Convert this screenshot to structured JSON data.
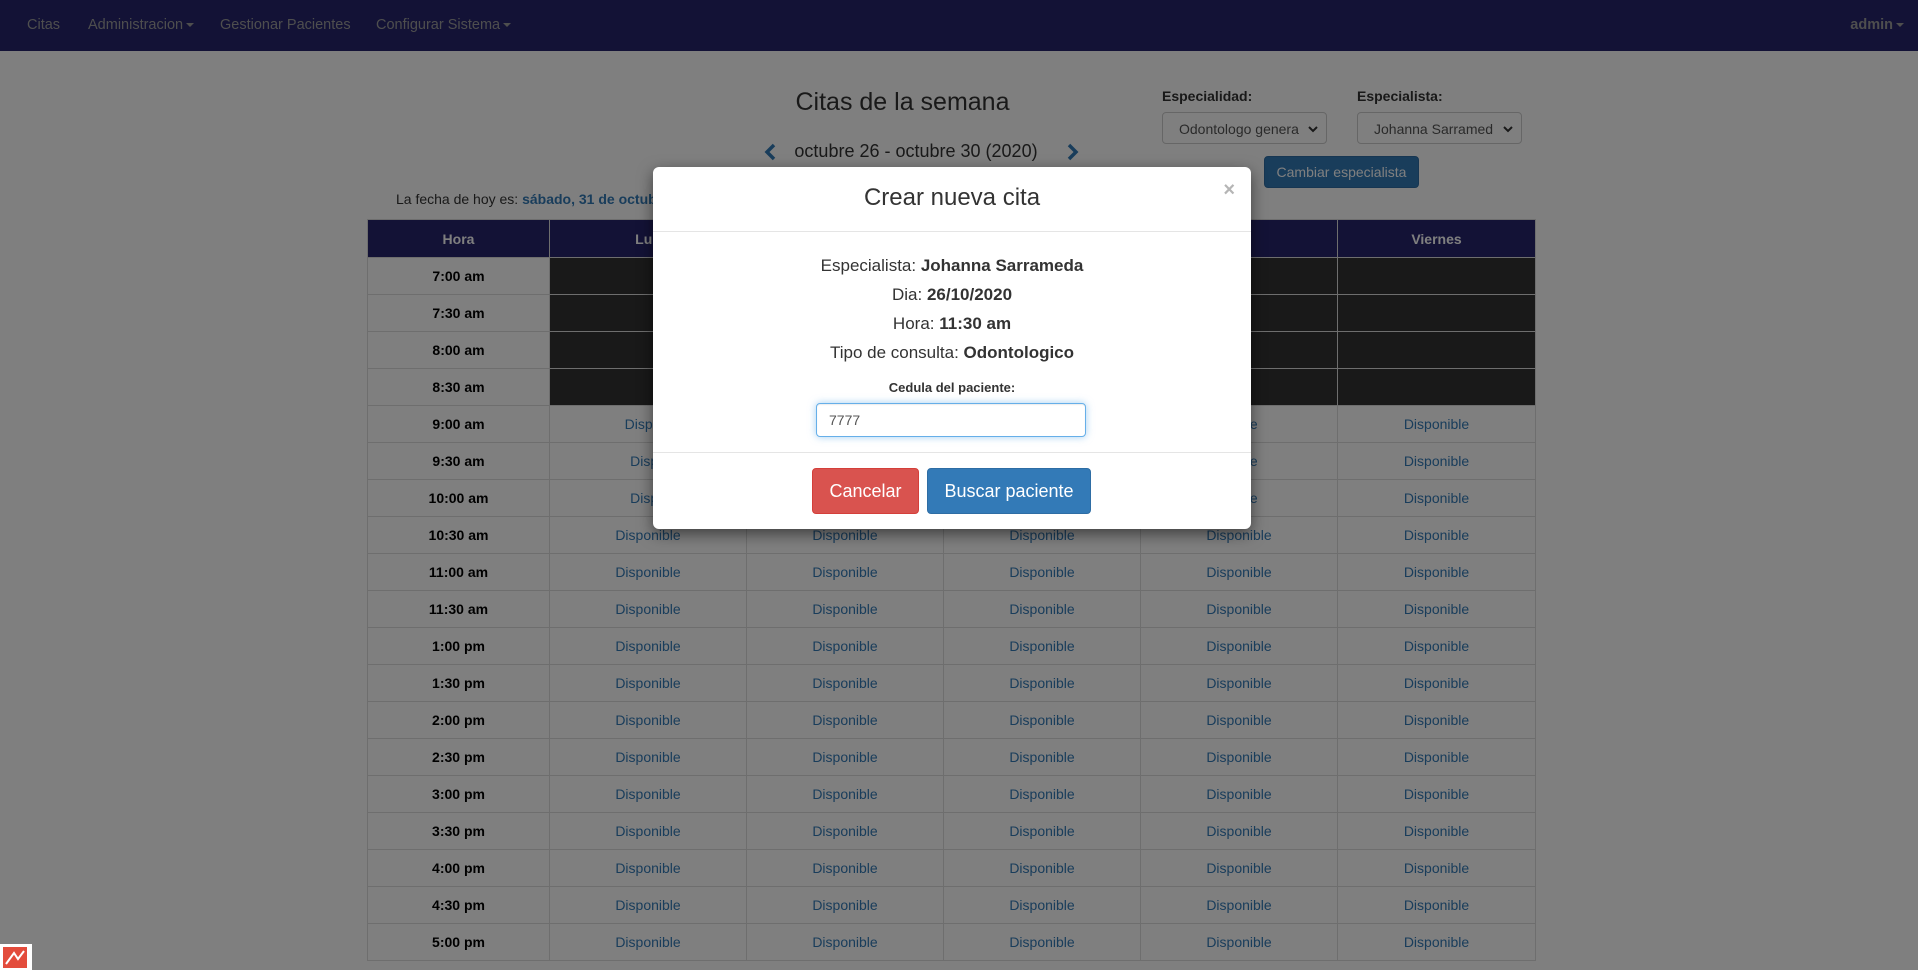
{
  "navbar": {
    "items": [
      "Citas",
      "Administracion",
      "Gestionar Pacientes",
      "Configurar Sistema"
    ],
    "user": "admin"
  },
  "page": {
    "title": "Citas de la semana",
    "week_label": "octubre 26 - octubre 30 (2020)",
    "today_prefix": "La fecha de hoy es:",
    "today_value": "sábado, 31 de octub",
    "especialidad_label": "Especialidad:",
    "especialidad_value": "Odontologo genera",
    "especialista_label": "Especialista:",
    "especialista_value": "Johanna Sarramed",
    "cambiar_button": "Cambiar especialista"
  },
  "calendar": {
    "headers": [
      "Hora",
      "Lun",
      "",
      "",
      "es",
      "Viernes"
    ],
    "rows": [
      {
        "hora": "7:00 am",
        "cells": [
          "",
          "",
          "",
          "",
          ""
        ],
        "status": "busy"
      },
      {
        "hora": "7:30 am",
        "cells": [
          "",
          "",
          "",
          "",
          ""
        ],
        "status": "busy"
      },
      {
        "hora": "8:00 am",
        "cells": [
          "",
          "",
          "",
          "",
          ""
        ],
        "status": "busy"
      },
      {
        "hora": "8:30 am",
        "cells": [
          "",
          "",
          "",
          "",
          ""
        ],
        "status": "busy"
      },
      {
        "hora": "9:00 am",
        "cells": [
          "Disponi",
          "",
          "",
          "onible",
          "Disponible"
        ],
        "status": "free"
      },
      {
        "hora": "9:30 am",
        "cells": [
          "Dispo",
          "",
          "",
          "onible",
          "Disponible"
        ],
        "status": "free"
      },
      {
        "hora": "10:00 am",
        "cells": [
          "Dispo",
          "",
          "",
          "onible",
          "Disponible"
        ],
        "status": "free"
      },
      {
        "hora": "10:30 am",
        "cells": [
          "Disponible",
          "Disponible",
          "Disponible",
          "Disponible",
          "Disponible"
        ],
        "status": "free"
      },
      {
        "hora": "11:00 am",
        "cells": [
          "Disponible",
          "Disponible",
          "Disponible",
          "Disponible",
          "Disponible"
        ],
        "status": "free"
      },
      {
        "hora": "11:30 am",
        "cells": [
          "Disponible",
          "Disponible",
          "Disponible",
          "Disponible",
          "Disponible"
        ],
        "status": "free"
      },
      {
        "hora": "1:00 pm",
        "cells": [
          "Disponible",
          "Disponible",
          "Disponible",
          "Disponible",
          "Disponible"
        ],
        "status": "free"
      },
      {
        "hora": "1:30 pm",
        "cells": [
          "Disponible",
          "Disponible",
          "Disponible",
          "Disponible",
          "Disponible"
        ],
        "status": "free"
      },
      {
        "hora": "2:00 pm",
        "cells": [
          "Disponible",
          "Disponible",
          "Disponible",
          "Disponible",
          "Disponible"
        ],
        "status": "free"
      },
      {
        "hora": "2:30 pm",
        "cells": [
          "Disponible",
          "Disponible",
          "Disponible",
          "Disponible",
          "Disponible"
        ],
        "status": "free"
      },
      {
        "hora": "3:00 pm",
        "cells": [
          "Disponible",
          "Disponible",
          "Disponible",
          "Disponible",
          "Disponible"
        ],
        "status": "free"
      },
      {
        "hora": "3:30 pm",
        "cells": [
          "Disponible",
          "Disponible",
          "Disponible",
          "Disponible",
          "Disponible"
        ],
        "status": "free"
      },
      {
        "hora": "4:00 pm",
        "cells": [
          "Disponible",
          "Disponible",
          "Disponible",
          "Disponible",
          "Disponible"
        ],
        "status": "free"
      },
      {
        "hora": "4:30 pm",
        "cells": [
          "Disponible",
          "Disponible",
          "Disponible",
          "Disponible",
          "Disponible"
        ],
        "status": "free"
      },
      {
        "hora": "5:00 pm",
        "cells": [
          "Disponible",
          "Disponible",
          "Disponible",
          "Disponible",
          "Disponible"
        ],
        "status": "free"
      }
    ]
  },
  "modal": {
    "title": "Crear nueva cita",
    "close_symbol": "×",
    "especialista_label": "Especialista:",
    "especialista_value": "Johanna Sarrameda",
    "dia_label": "Dia:",
    "dia_value": "26/10/2020",
    "hora_label": "Hora:",
    "hora_value": "11:30 am",
    "tipo_label": "Tipo de consulta:",
    "tipo_value": "Odontologico",
    "cedula_label": "Cedula del paciente:",
    "cedula_value": "7777",
    "cancel_button": "Cancelar",
    "search_button": "Buscar paciente"
  },
  "colors": {
    "navbar": "#26256d",
    "primary": "#337ab7",
    "danger": "#d9534f",
    "busy_cell": "#333333"
  },
  "icons": [
    "chevron-left-icon",
    "chevron-right-icon",
    "caret-down-icon",
    "close-icon",
    "corner-badge-icon"
  ]
}
